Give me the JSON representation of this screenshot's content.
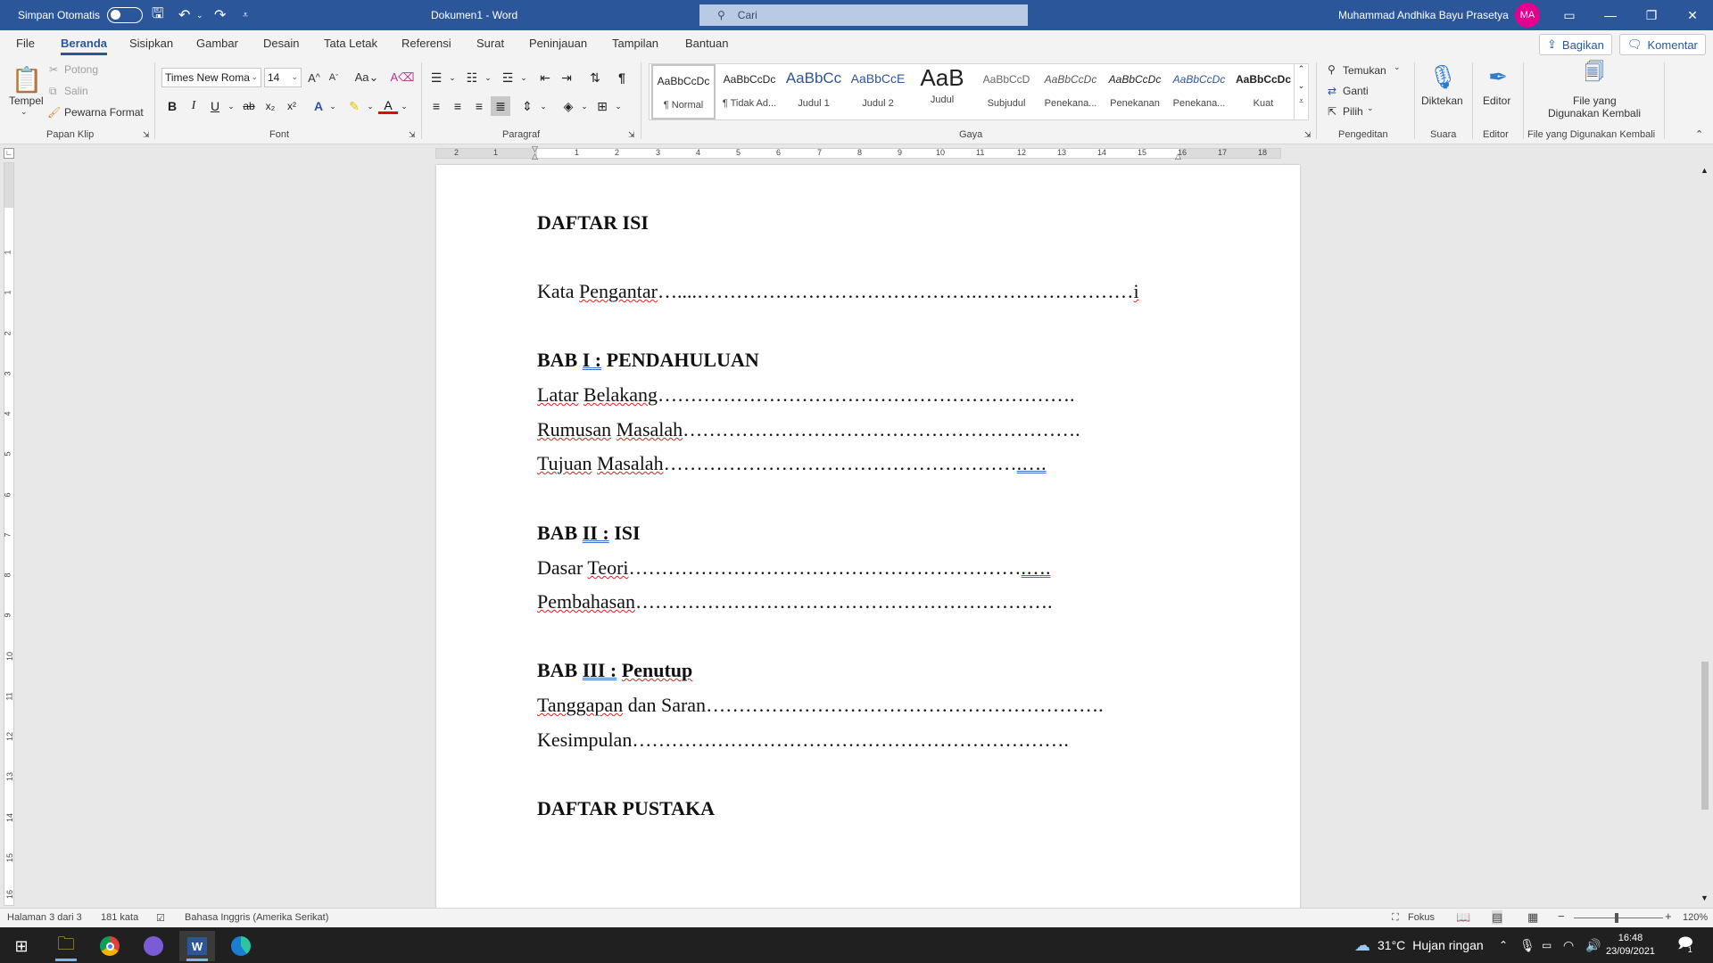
{
  "titlebar": {
    "autosave_label": "Simpan Otomatis",
    "doc_title": "Dokumen1  -  Word",
    "search_placeholder": "Cari",
    "user_name": "Muhammad Andhika Bayu Prasetya",
    "user_initials": "MA",
    "accent": "#2b579a"
  },
  "menu": {
    "tabs": [
      "File",
      "Beranda",
      "Sisipkan",
      "Gambar",
      "Desain",
      "Tata Letak",
      "Referensi",
      "Surat",
      "Peninjauan",
      "Tampilan",
      "Bantuan"
    ],
    "active_tab": "Beranda",
    "share_label": "Bagikan",
    "comment_label": "Komentar"
  },
  "ribbon": {
    "clipboard": {
      "paste": "Tempel",
      "cut": "Potong",
      "copy": "Salin",
      "format_painter": "Pewarna Format",
      "label": "Papan Klip"
    },
    "font": {
      "name": "Times New Roma",
      "size": "14",
      "label": "Font"
    },
    "paragraph": {
      "label": "Paragraf"
    },
    "styles": {
      "label": "Gaya",
      "items": [
        {
          "sample": "AaBbCcDc",
          "name": "¶ Normal"
        },
        {
          "sample": "AaBbCcDc",
          "name": "¶ Tidak Ad..."
        },
        {
          "sample": "AaBbCc",
          "name": "Judul 1"
        },
        {
          "sample": "AaBbCcE",
          "name": "Judul 2"
        },
        {
          "sample": "AaB",
          "name": "Judul"
        },
        {
          "sample": "AaBbCcD",
          "name": "Subjudul"
        },
        {
          "sample": "AaBbCcDc",
          "name": "Penekana..."
        },
        {
          "sample": "AaBbCcDc",
          "name": "Penekanan"
        },
        {
          "sample": "AaBbCcDc",
          "name": "Penekana..."
        },
        {
          "sample": "AaBbCcDc",
          "name": "Kuat"
        }
      ]
    },
    "editing": {
      "find": "Temukan",
      "replace": "Ganti",
      "select": "Pilih",
      "label": "Pengeditan"
    },
    "voice": {
      "dictate": "Diktekan",
      "label": "Suara"
    },
    "editor": {
      "button": "Editor",
      "label": "Editor"
    },
    "reuse": {
      "button_line1": "File yang",
      "button_line2": "Digunakan Kembali",
      "label": "File yang Digunakan Kembali"
    }
  },
  "ruler": {
    "numbers": [
      "2",
      "1",
      "1",
      "2",
      "3",
      "4",
      "5",
      "6",
      "7",
      "8",
      "9",
      "10",
      "11",
      "12",
      "13",
      "14",
      "15",
      "16",
      "17",
      "18"
    ],
    "vnumbers": [
      "1",
      "1",
      "2",
      "3",
      "4",
      "5",
      "6",
      "7",
      "8",
      "9",
      "10",
      "11",
      "12",
      "13",
      "14",
      "15",
      "16"
    ]
  },
  "document": {
    "heading_toc": "DAFTAR ISI",
    "kata_pengantar_a": "Kata ",
    "kata_pengantar_b": "Pengantar",
    "kata_pengantar_dots": "…....…………………………………….……………………",
    "kata_pengantar_page": "i",
    "bab1_a": "BAB ",
    "bab1_num": "I :",
    "bab1_b": " PENDAHULUAN",
    "latar_a": "Latar",
    "latar_b": " ",
    "latar_c": "Belakang",
    "latar_dots": "……………………………………………………….",
    "rumusan_a": "Rumusan",
    "rumusan_b": " ",
    "rumusan_c": "Masalah",
    "rumusan_dots": "…………………………………………………….",
    "tujuan_a": "Tujuan",
    "tujuan_b": " ",
    "tujuan_c": "Masalah",
    "tujuan_dots": "………………………………………………",
    "tujuan_tail": ".….",
    "bab2_a": "BAB ",
    "bab2_num": "II :",
    "bab2_b": " ISI",
    "dasar_a": "Dasar ",
    "dasar_b": "Teori",
    "dasar_dots": "……………………………………………………",
    "dasar_tail": ".….",
    "pembahasan": "Pembahasan",
    "pembahasan_dots": "……………………………………………………….",
    "bab3_a": "BAB ",
    "bab3_num": "III :",
    "bab3_b": " ",
    "bab3_c": "Penutup",
    "tanggapan_a": "Tanggapan",
    "tanggapan_b": " dan Saran",
    "tanggapan_dots": "…………………………………………………….",
    "kesimpulan": "Kesimpulan",
    "kesimpulan_dots": "………………………………………………………….",
    "heading_refs": "DAFTAR PUSTAKA"
  },
  "status": {
    "page": "Halaman 3 dari 3",
    "words": "181 kata",
    "language": "Bahasa Inggris (Amerika Serikat)",
    "focus": "Fokus",
    "zoom": "120%"
  },
  "taskbar": {
    "temperature": "31°C",
    "weather": "Hujan ringan",
    "time": "16:48",
    "date": "23/09/2021",
    "notification_count": "1"
  }
}
